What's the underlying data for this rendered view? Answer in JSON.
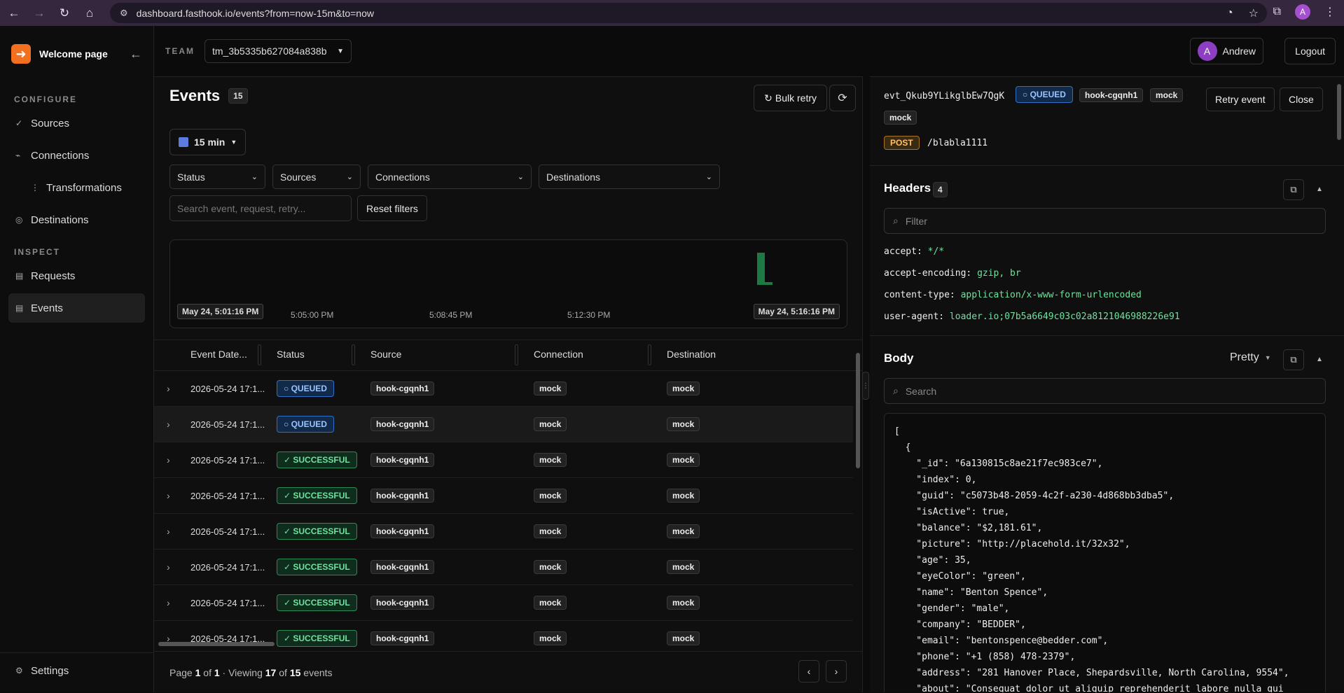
{
  "browser": {
    "url": "dashboard.fasthook.io/events?from=now-15m&to=now",
    "profile_initial": "A"
  },
  "sidebar": {
    "brand": "Welcome page",
    "configure_label": "CONFIGURE",
    "inspect_label": "INSPECT",
    "items": [
      {
        "label": "Sources"
      },
      {
        "label": "Connections"
      },
      {
        "label": "Transformations"
      },
      {
        "label": "Destinations"
      },
      {
        "label": "Requests"
      },
      {
        "label": "Events"
      }
    ],
    "settings": "Settings"
  },
  "topbar": {
    "team_label": "TEAM",
    "team_value": "tm_3b5335b627084a838b",
    "user_initial": "A",
    "user_name": "Andrew",
    "logout": "Logout"
  },
  "events": {
    "title": "Events",
    "count": "15",
    "bulk_retry": "Bulk retry",
    "range": "15 min",
    "filters": {
      "status": "Status",
      "sources": "Sources",
      "connections": "Connections",
      "destinations": "Destinations",
      "search_placeholder": "Search event, request, retry...",
      "reset": "Reset filters"
    },
    "histogram": {
      "start": "May 24, 5:01:16 PM",
      "end": "May 24, 5:16:16 PM",
      "ticks": [
        "5:05:00 PM",
        "5:08:45 PM",
        "5:12:30 PM"
      ]
    },
    "columns": [
      "Event Date...",
      "Status",
      "Source",
      "Connection",
      "Destination"
    ],
    "rows": [
      {
        "date": "2026-05-24 17:1...",
        "status": "○ QUEUED",
        "source": "hook-cgqnh1",
        "connection": "mock",
        "destination": "mock"
      },
      {
        "date": "2026-05-24 17:1...",
        "status": "○ QUEUED",
        "source": "hook-cgqnh1",
        "connection": "mock",
        "destination": "mock"
      },
      {
        "date": "2026-05-24 17:1...",
        "status": "✓ SUCCESSFUL",
        "source": "hook-cgqnh1",
        "connection": "mock",
        "destination": "mock"
      },
      {
        "date": "2026-05-24 17:1...",
        "status": "✓ SUCCESSFUL",
        "source": "hook-cgqnh1",
        "connection": "mock",
        "destination": "mock"
      },
      {
        "date": "2026-05-24 17:1...",
        "status": "✓ SUCCESSFUL",
        "source": "hook-cgqnh1",
        "connection": "mock",
        "destination": "mock"
      },
      {
        "date": "2026-05-24 17:1...",
        "status": "✓ SUCCESSFUL",
        "source": "hook-cgqnh1",
        "connection": "mock",
        "destination": "mock"
      },
      {
        "date": "2026-05-24 17:1...",
        "status": "✓ SUCCESSFUL",
        "source": "hook-cgqnh1",
        "connection": "mock",
        "destination": "mock"
      },
      {
        "date": "2026-05-24 17:1...",
        "status": "✓ SUCCESSFUL",
        "source": "hook-cgqnh1",
        "connection": "mock",
        "destination": "mock"
      }
    ],
    "footer": {
      "page_word": "Page",
      "page": "1",
      "of_word": "of",
      "total_pages": "1",
      "viewing_word": "· Viewing",
      "viewing": "17",
      "of_word2": "of",
      "total": "15",
      "events_word": "events"
    }
  },
  "detail": {
    "event_id": "evt_Qkub9YLikglbEw7QgK",
    "status": "○ QUEUED",
    "tags": [
      "hook-cgqnh1",
      "mock",
      "mock"
    ],
    "retry": "Retry event",
    "close": "Close",
    "method": "POST",
    "path": "/blabla1111",
    "headers_title": "Headers",
    "headers_count": "4",
    "filter_placeholder": "Filter",
    "headers": [
      {
        "k": "accept:",
        "v": "*/*"
      },
      {
        "k": "accept-encoding:",
        "v": "gzip, br"
      },
      {
        "k": "content-type:",
        "v": "application/x-www-form-urlencoded"
      },
      {
        "k": "user-agent:",
        "v": "loader.io;07b5a6649c03c02a8121046988226e91"
      }
    ],
    "body_title": "Body",
    "body_mode": "Pretty",
    "search_placeholder": "Search",
    "body_lines": [
      "[",
      "  {",
      "    \"_id\": \"6a130815c8ae21f7ec983ce7\",",
      "    \"index\": 0,",
      "    \"guid\": \"c5073b48-2059-4c2f-a230-4d868bb3dba5\",",
      "    \"isActive\": true,",
      "    \"balance\": \"$2,181.61\",",
      "    \"picture\": \"http://placehold.it/32x32\",",
      "    \"age\": 35,",
      "    \"eyeColor\": \"green\",",
      "    \"name\": \"Benton Spence\",",
      "    \"gender\": \"male\",",
      "    \"company\": \"BEDDER\",",
      "    \"email\": \"bentonspence@bedder.com\",",
      "    \"phone\": \"+1 (858) 478-2379\",",
      "    \"address\": \"281 Hanover Place, Shepardsville, North Carolina, 9554\",",
      "    \"about\": \"Consequat dolor ut aliquip reprehenderit labore nulla qui"
    ]
  },
  "colors": {
    "accent": "#f37021",
    "queued": "#2f6fc9",
    "success": "#2a8b55",
    "bar": "#1d7a44"
  }
}
